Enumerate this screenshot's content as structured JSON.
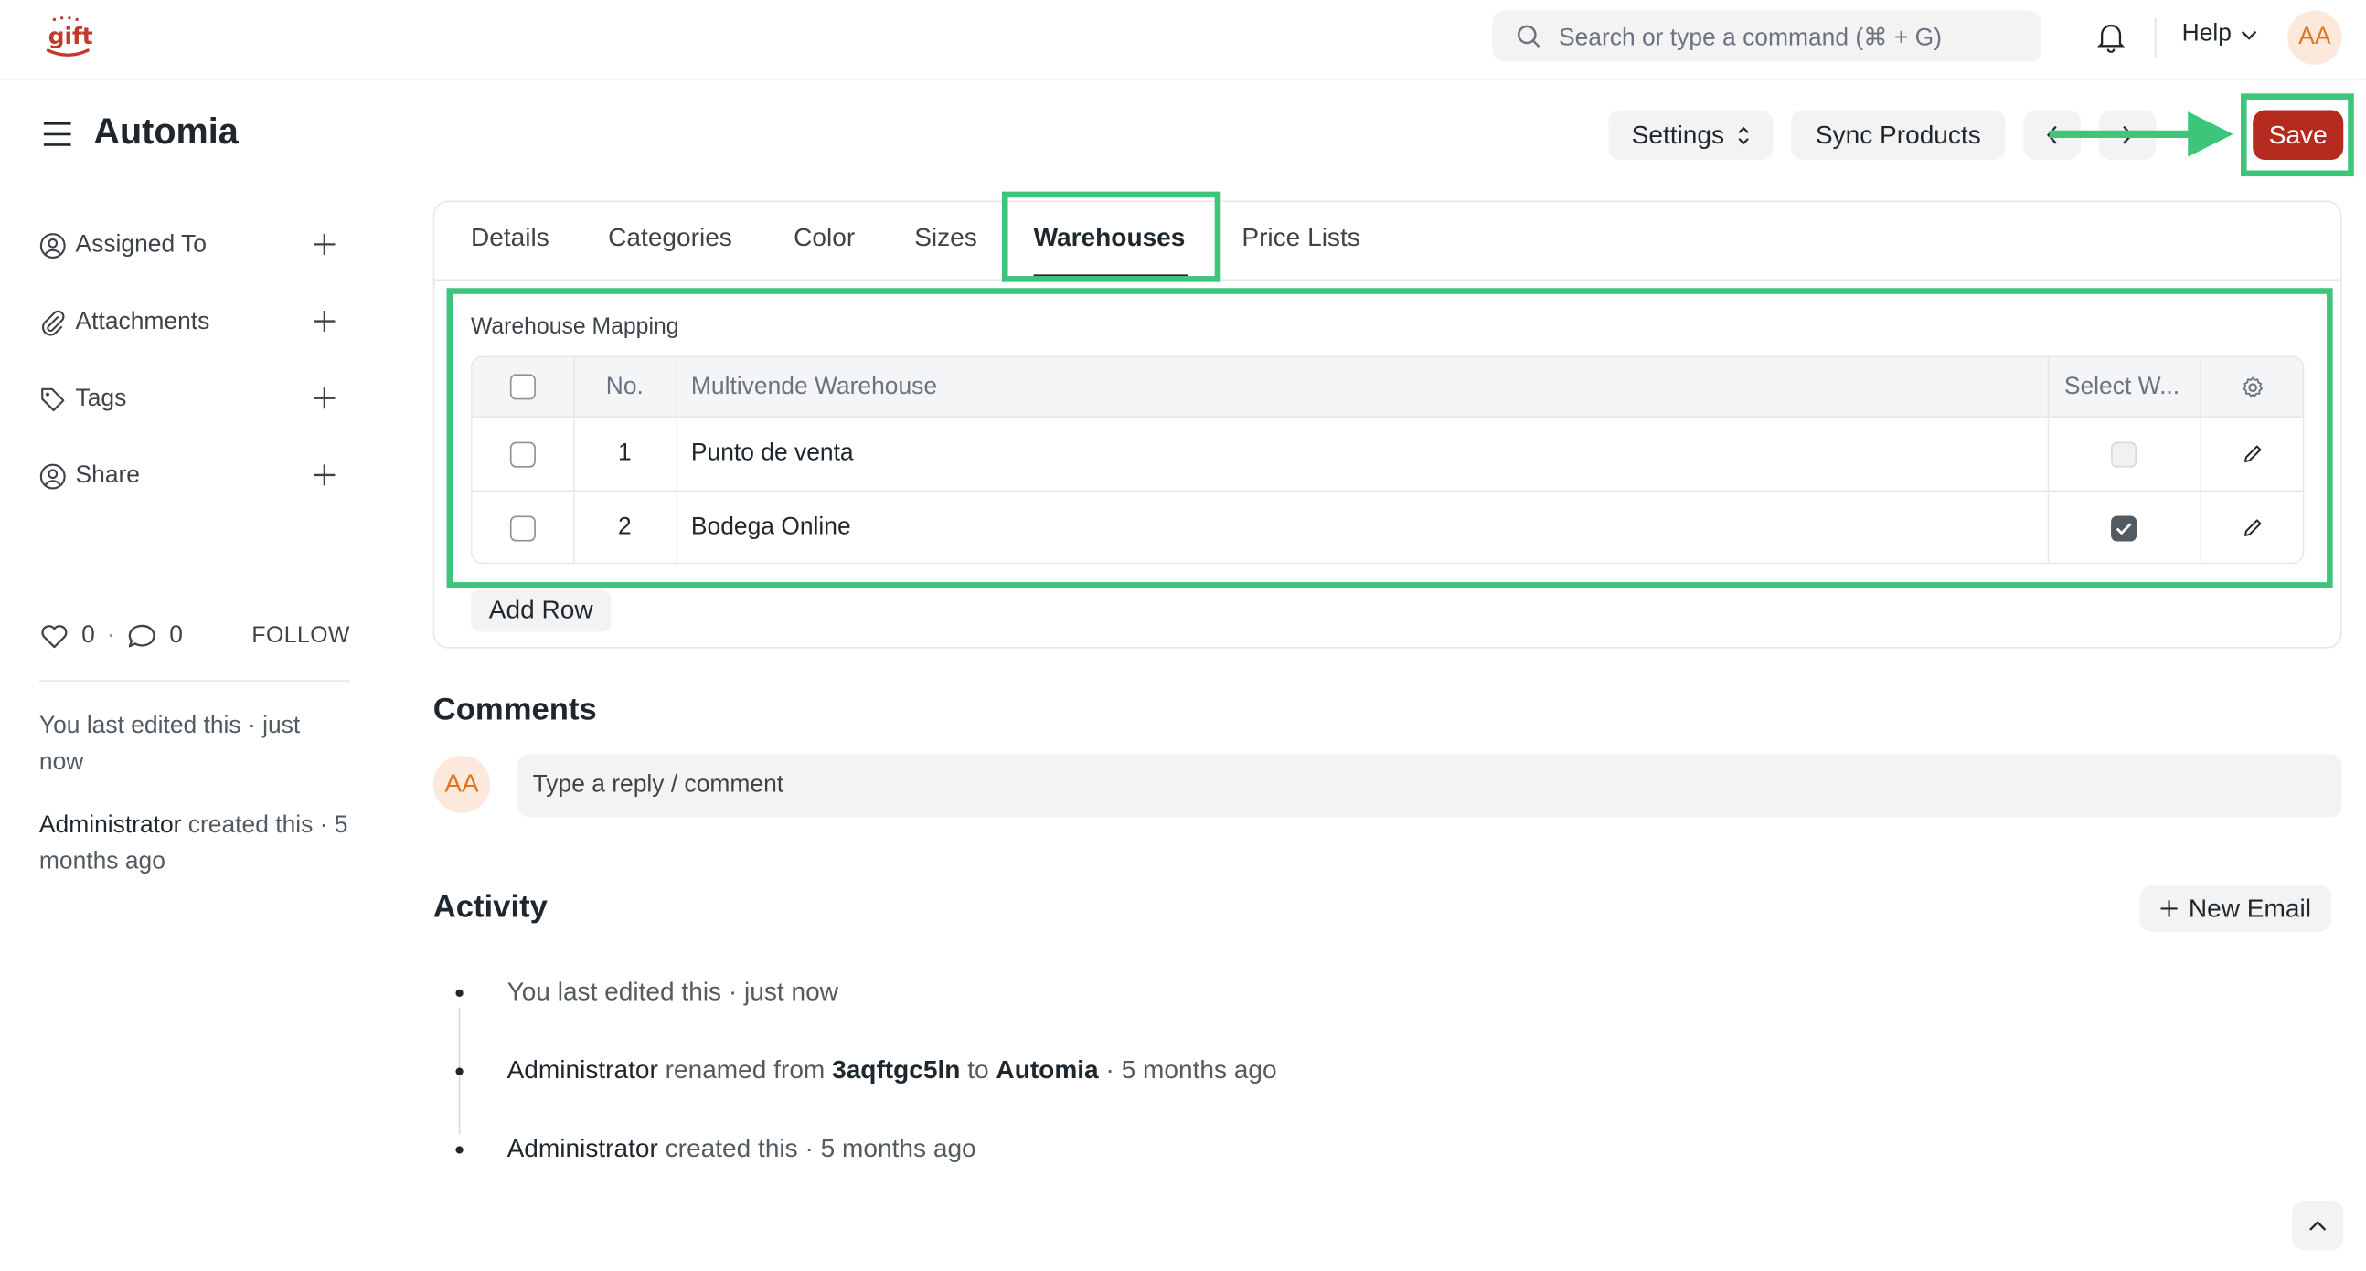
{
  "navbar": {
    "logo_text": "gift",
    "search_placeholder": "Search or type a command (⌘ + G)",
    "help_label": "Help",
    "avatar_initials": "AA"
  },
  "header": {
    "title": "Automia",
    "settings_label": "Settings",
    "sync_label": "Sync Products",
    "save_label": "Save"
  },
  "sidebar": {
    "items": [
      {
        "label": "Assigned To",
        "icon": "user-add-icon"
      },
      {
        "label": "Attachments",
        "icon": "paperclip-icon"
      },
      {
        "label": "Tags",
        "icon": "tag-icon"
      },
      {
        "label": "Share",
        "icon": "share-user-icon"
      }
    ],
    "likes": "0",
    "comments": "0",
    "follow_label": "FOLLOW",
    "last_edited": "You last edited this · just now",
    "created_by": "Administrator",
    "created_suffix": " created this · 5 months ago"
  },
  "tabs": [
    "Details",
    "Categories",
    "Color",
    "Sizes",
    "Warehouses",
    "Price Lists"
  ],
  "active_tab": "Warehouses",
  "warehouse_section": {
    "label": "Warehouse Mapping",
    "columns": {
      "no": "No.",
      "warehouse": "Multivende Warehouse",
      "select": "Select W..."
    },
    "rows": [
      {
        "no": "1",
        "warehouse": "Punto de venta",
        "selected": false
      },
      {
        "no": "2",
        "warehouse": "Bodega Online",
        "selected": true
      }
    ],
    "add_row_label": "Add Row"
  },
  "comments": {
    "heading": "Comments",
    "avatar_initials": "AA",
    "placeholder": "Type a reply / comment"
  },
  "activity": {
    "heading": "Activity",
    "new_email_label": "New Email",
    "items": [
      {
        "text": "You last edited this · just now"
      },
      {
        "actor": "Administrator",
        "mid": " renamed from ",
        "from": "3aqftgc5ln",
        "to_word": " to ",
        "to": "Automia",
        "time": " · 5 months ago"
      },
      {
        "actor": "Administrator",
        "rest": " created this · 5 months ago"
      }
    ]
  },
  "colors": {
    "highlight": "#3dc57c",
    "save_button": "#b52a1e",
    "avatar_bg": "#fde9dc",
    "avatar_text": "#e2741b"
  }
}
